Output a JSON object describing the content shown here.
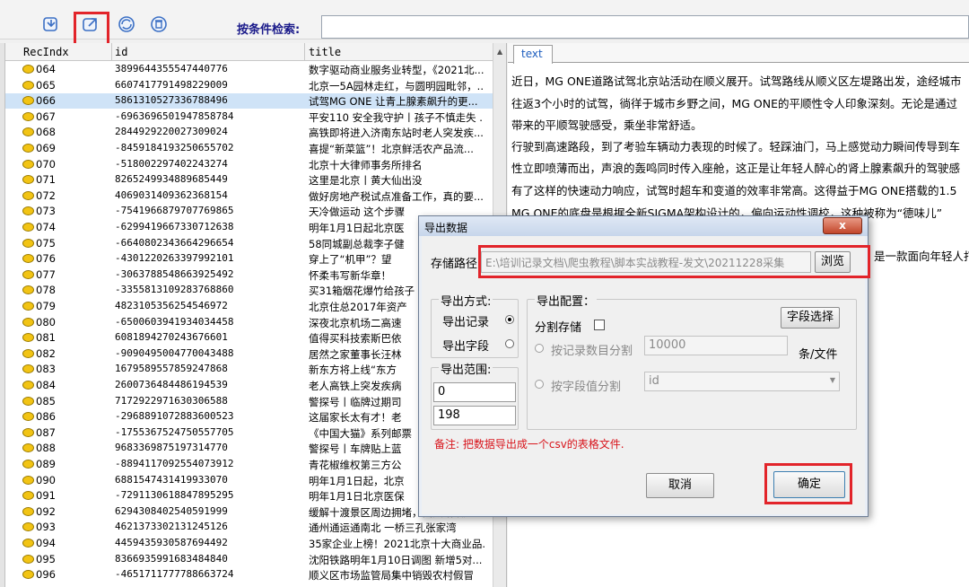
{
  "toolbar": {
    "search_label": "按条件检索:",
    "search_value": "",
    "icons": [
      "import-icon",
      "export-icon",
      "refresh-icon",
      "delete-icon"
    ]
  },
  "grid": {
    "headers": [
      "RecIndx",
      "id",
      "title"
    ],
    "rows": [
      {
        "idx": "064",
        "id": "3899644355547440776",
        "title": "数字驱动商业服务业转型，《2021北..."
      },
      {
        "idx": "065",
        "id": "6607417791498229009",
        "title": "北京一5A园林走红，与圆明园毗邻，.."
      },
      {
        "idx": "066",
        "id": "5861310527336788496",
        "title": "试驾MG ONE 让青上腺素飙升的更..."
      },
      {
        "idx": "067",
        "id": "-6963696501947858784",
        "title": "平安110 安全我守护丨孩子不慎走失 ."
      },
      {
        "idx": "068",
        "id": "2844929220027309024",
        "title": "高铁即将进入济南东站时老人突发疾..."
      },
      {
        "idx": "069",
        "id": "-8459184193250655702",
        "title": "喜提“新菜篮”！北京鲜活农产品流..."
      },
      {
        "idx": "070",
        "id": "-518002297402243274",
        "title": "北京十大律师事务所排名"
      },
      {
        "idx": "071",
        "id": "8265249934889685449",
        "title": "这里是北京丨黄大仙出没"
      },
      {
        "idx": "072",
        "id": "4069031409362368154",
        "title": "做好房地产税试点准备工作，真的要..."
      },
      {
        "idx": "073",
        "id": "-7541966879707769865",
        "title": "天冷做运动 这个步骤"
      },
      {
        "idx": "074",
        "id": "-6299419667330712638",
        "title": "明年1月1日起北京医"
      },
      {
        "idx": "075",
        "id": "-6640802343664296654",
        "title": "58同城副总裁李子健"
      },
      {
        "idx": "076",
        "id": "-4301220263397992101",
        "title": "穿上了“机甲”？望"
      },
      {
        "idx": "077",
        "id": "-3063788548663925492",
        "title": "怀柔韦写新华章！"
      },
      {
        "idx": "078",
        "id": "-3355813109283768860",
        "title": "买31箱烟花爆竹给孩子"
      },
      {
        "idx": "079",
        "id": "4823105356254546972",
        "title": "北京住总2017年资产"
      },
      {
        "idx": "080",
        "id": "-6500603941934034458",
        "title": "深夜北京机场二高速"
      },
      {
        "idx": "081",
        "id": "6081894270243676601",
        "title": "值得买科技索斯巴依"
      },
      {
        "idx": "082",
        "id": "-9090495004770043488",
        "title": "居然之家董事长汪林"
      },
      {
        "idx": "083",
        "id": "1679589557859247868",
        "title": "新东方将上线“东方"
      },
      {
        "idx": "084",
        "id": "2600736484486194539",
        "title": "老人高铁上突发疾病"
      },
      {
        "idx": "085",
        "id": "7172922971630306588",
        "title": "警探号丨临牌过期司"
      },
      {
        "idx": "086",
        "id": "-2968891072883600523",
        "title": "这届家长太有才！老"
      },
      {
        "idx": "087",
        "id": "-1755367524750557705",
        "title": "《中国大猫》系列邮票"
      },
      {
        "idx": "088",
        "id": "9683369875197314770",
        "title": "警探号丨车牌贴上蓝"
      },
      {
        "idx": "089",
        "id": "-8894117092554073912",
        "title": "青花椒维权第三方公"
      },
      {
        "idx": "090",
        "id": "6881547431419933070",
        "title": "明年1月1日起，北京"
      },
      {
        "idx": "091",
        "id": "-7291130618847895295",
        "title": "明年1月1日北京医保"
      },
      {
        "idx": "092",
        "id": "6294308402540591999",
        "title": "缓解十渡景区周边拥堵，西太路改建..."
      },
      {
        "idx": "093",
        "id": "4621373302131245126",
        "title": "通州通运通南北 一桥三孔张家湾"
      },
      {
        "idx": "094",
        "id": "4459435930587694492",
        "title": "35家企业上榜！2021北京十大商业品."
      },
      {
        "idx": "095",
        "id": "8366935991683484840",
        "title": "沈阳铁路明年1月10日调图 新增5对..."
      },
      {
        "idx": "096",
        "id": "-4651711777788663724",
        "title": "顺义区市场监管局集中销毁农村假冒"
      }
    ]
  },
  "text_panel": {
    "tab_label": "text",
    "paragraphs": [
      "近日，MG ONE道路试驾北京站活动在顺义展开。试驾路线从顺义区左堤路出发，途经城市",
      "往返3个小时的试驾，徜徉于城市乡野之间，MG ONE的平顺性令人印象深刻。无论是通过",
      "带来的平顺驾驶感受，乘坐非常舒适。",
      "行驶到高速路段，到了考验车辆动力表现的时候了。轻踩油门，马上感觉动力瞬间传导到车",
      "性立即喷薄而出，声浪的轰鸣同时传入座舱，这正是让年轻人醉心的肾上腺素飙升的驾驶感",
      "有了这样的快速动力响应，试驾时超车和变道的效率非常高。这得益于MG ONE搭载的1.5",
      "MG ONE的底盘是根据全新SIGMA架构设计的，偏向运动性调校，这种被称为“德味儿”"
    ],
    "partial_line": "是一款面向年轻人打"
  },
  "dialog": {
    "title": "导出数据",
    "close_label": "x",
    "path_label": "存储路径:",
    "path_value": "E:\\培训记录文档\\爬虫教程\\脚本实战教程-发文\\20211228采集",
    "browse_label": "浏览",
    "method_group": "导出方式:",
    "method_record": "导出记录",
    "method_field": "导出字段",
    "range_group": "导出范围:",
    "range_start": "0",
    "range_end": "198",
    "config_group": "导出配置：",
    "split_label": "分割存储",
    "field_select_label": "字段选择",
    "split_by_count_label": "按记录数目分割",
    "split_count_value": "10000",
    "per_file_label": "条/文件",
    "split_by_field_label": "按字段值分割",
    "split_field_value": "id",
    "note": "备注: 把数据导出成一个csv的表格文件.",
    "cancel_label": "取消",
    "ok_label": "确定"
  },
  "colors": {
    "highlight": "#e2242a",
    "note": "#d8141b",
    "selected_row": "#cfe3f7",
    "tab_text": "#1f5fbf"
  }
}
